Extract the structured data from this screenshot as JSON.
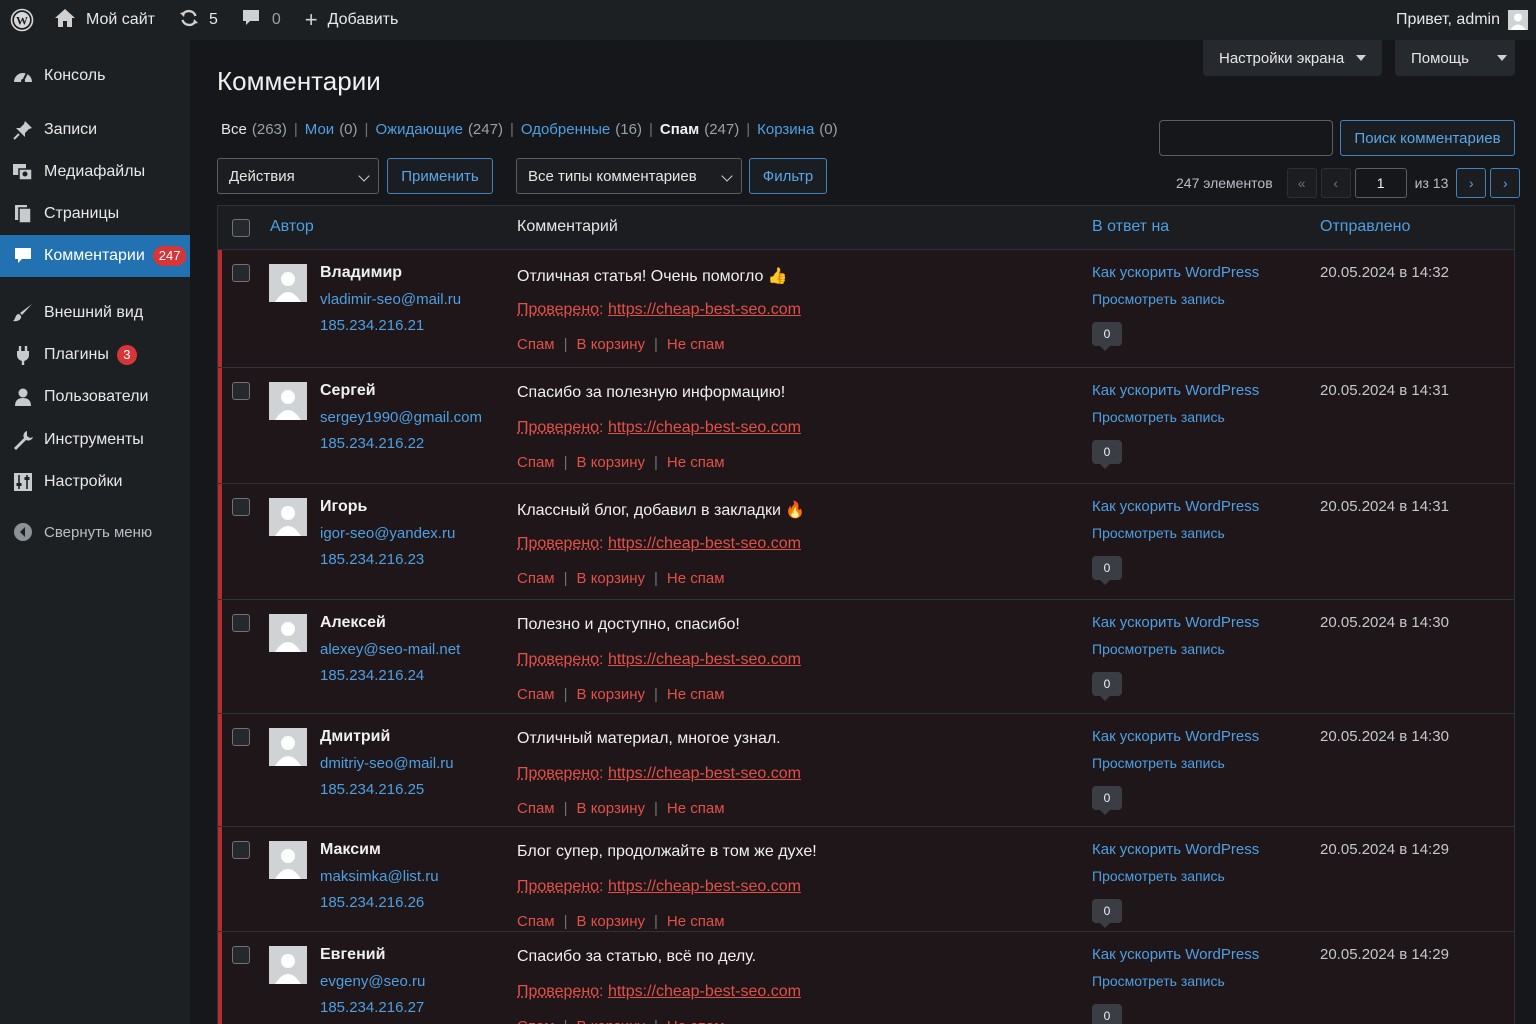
{
  "adminbar": {
    "site_name": "Мой сайт",
    "updates_count": "5",
    "comments_count": "0",
    "new_label": "Добавить",
    "greeting": "Привет, admin"
  },
  "sidebar": {
    "items": [
      {
        "label": "Консоль",
        "icon": "dashboard-icon"
      },
      {
        "label": "Записи",
        "icon": "pin-icon"
      },
      {
        "label": "Медиафайлы",
        "icon": "media-icon"
      },
      {
        "label": "Страницы",
        "icon": "pages-icon"
      },
      {
        "label": "Комментарии",
        "icon": "comments-icon",
        "badge": "247",
        "active": true
      },
      {
        "label": "Внешний вид",
        "icon": "brush-icon"
      },
      {
        "label": "Плагины",
        "icon": "plugin-icon",
        "badge": "3"
      },
      {
        "label": "Пользователи",
        "icon": "users-icon"
      },
      {
        "label": "Инструменты",
        "icon": "wrench-icon"
      },
      {
        "label": "Настройки",
        "icon": "settings-icon"
      }
    ],
    "collapse_label": "Свернуть меню"
  },
  "header": {
    "screen_options": "Настройки экрана",
    "help": "Помощь",
    "title": "Комментарии"
  },
  "filters": [
    {
      "label": "Все",
      "count": "(263)",
      "link": false
    },
    {
      "label": "Мои",
      "count": "(0)",
      "link": true
    },
    {
      "label": "Ожидающие",
      "count": "(247)",
      "link": true
    },
    {
      "label": "Одобренные",
      "count": "(16)",
      "link": true
    },
    {
      "label": "Спам",
      "count": "(247)",
      "current": true
    },
    {
      "label": "Корзина",
      "count": "(0)",
      "link": true
    }
  ],
  "search": {
    "value": "",
    "button": "Поиск комментариев"
  },
  "toolbar": {
    "bulk_actions": "Действия",
    "apply": "Применить",
    "comment_type": "Все типы комментариев",
    "filter": "Фильтр"
  },
  "pagination": {
    "total": "247 элементов",
    "first": "«",
    "prev": "‹",
    "current": "1",
    "of": "из 13",
    "next": "›",
    "last": "›"
  },
  "table": {
    "columns": {
      "author": "Автор",
      "comment": "Комментарий",
      "response": "В ответ на",
      "submitted": "Отправлено"
    },
    "verified_label": "Проверено",
    "verified_sep": ": ",
    "actions": {
      "spam": "Спам",
      "trash": "В корзину",
      "not_spam": "Не спам"
    },
    "rows": [
      {
        "name": "Владимир",
        "email": "vladimir-seo@mail.ru",
        "ip": "185.234.216.21",
        "text": "Отличная статья! Очень помогло 👍",
        "link": "https://cheap-best-seo.com",
        "post": "Как ускорить WordPress",
        "view": "Просмотреть запись",
        "count": "0",
        "date": "20.05.2024 в 14:32"
      },
      {
        "name": "Сергей",
        "email": "sergey1990@gmail.com",
        "ip": "185.234.216.22",
        "text": "Спасибо за полезную информацию!",
        "link": "https://cheap-best-seo.com",
        "post": "Как ускорить WordPress",
        "view": "Просмотреть запись",
        "count": "0",
        "date": "20.05.2024 в 14:31"
      },
      {
        "name": "Игорь",
        "email": "igor-seo@yandex.ru",
        "ip": "185.234.216.23",
        "text": "Классный блог, добавил в закладки 🔥",
        "link": "https://cheap-best-seo.com",
        "post": "Как ускорить WordPress",
        "view": "Просмотреть запись",
        "count": "0",
        "date": "20.05.2024 в 14:31"
      },
      {
        "name": "Алексей",
        "email": "alexey@seo-mail.net",
        "ip": "185.234.216.24",
        "text": "Полезно и доступно, спасибо!",
        "link": "https://cheap-best-seo.com",
        "post": "Как ускорить WordPress",
        "view": "Просмотреть запись",
        "count": "0",
        "date": "20.05.2024 в 14:30"
      },
      {
        "name": "Дмитрий",
        "email": "dmitriy-seo@mail.ru",
        "ip": "185.234.216.25",
        "text": "Отличный материал, многое узнал.",
        "link": "https://cheap-best-seo.com",
        "post": "Как ускорить WordPress",
        "view": "Просмотреть запись",
        "count": "0",
        "date": "20.05.2024 в 14:30"
      },
      {
        "name": "Максим",
        "email": "maksimka@list.ru",
        "ip": "185.234.216.26",
        "text": "Блог супер, продолжайте в том же духе!",
        "link": "https://cheap-best-seo.com",
        "post": "Как ускорить WordPress",
        "view": "Просмотреть запись",
        "count": "0",
        "date": "20.05.2024 в 14:29"
      },
      {
        "name": "Евгений",
        "email": "evgeny@seo.ru",
        "ip": "185.234.216.27",
        "text": "Спасибо за статью, всё по делу.",
        "link": "https://cheap-best-seo.com",
        "post": "Как ускорить WordPress",
        "view": "Просмотреть запись",
        "count": "0",
        "date": "20.05.2024 в 14:29"
      }
    ]
  },
  "colors": {
    "accent": "#2271b1",
    "link": "#4f9fe3",
    "spam": "#e2504a",
    "badge": "#d63638"
  }
}
